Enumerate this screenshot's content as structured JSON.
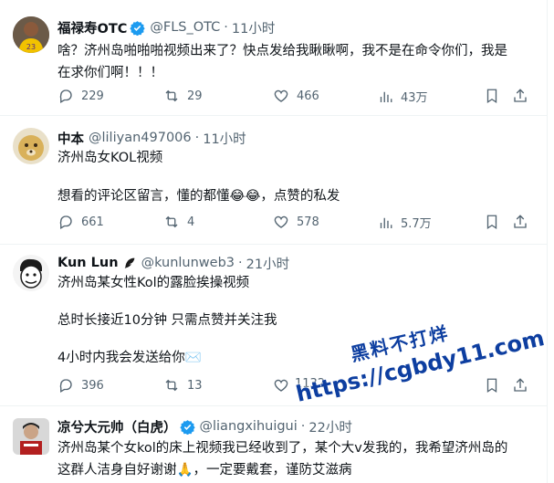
{
  "tweets": [
    {
      "name": "福禄寿OTC",
      "verified": true,
      "handle": "@FLS_OTC",
      "time": "11小时",
      "lines": [
        "啥？济州岛啪啪啪视频出来了？快点发给我瞅瞅啊，我不是在命令你们，我是",
        "在求你们啊！！！"
      ],
      "replies": "229",
      "retweets": "29",
      "likes": "466",
      "views": "43万"
    },
    {
      "name": "中本",
      "verified": false,
      "handle": "@liliyan497006",
      "time": "11小时",
      "lines": [
        "济州岛女KOL视频",
        "",
        "想看的评论区留言，懂的都懂😂😂，点赞的私发"
      ],
      "replies": "661",
      "retweets": "4",
      "likes": "578",
      "views": "5.7万"
    },
    {
      "name": "Kun Lun",
      "verified": false,
      "handle": "@kunlunweb3",
      "time": "21小时",
      "lines": [
        "济州岛某女性Kol的露脸挨操视频",
        "",
        "总时长接近10分钟 只需点赞并关注我",
        "",
        "4小时内我会发送给你✉️"
      ],
      "replies": "396",
      "retweets": "13",
      "likes": "",
      "views": "1132"
    },
    {
      "name": "凉兮大元帅（白虎）",
      "verified": true,
      "handle": "@liangxihuigui",
      "time": "22小时",
      "lines": [
        "济州岛某个女kol的床上视频我已经收到了，某个大v发我的，我希望济州岛的",
        "这群人洁身自好谢谢🙏，一定要戴套，谨防艾滋病"
      ],
      "replies": "",
      "retweets": "",
      "likes": "",
      "views": ""
    }
  ],
  "watermark": {
    "line1": "黑料不打烊",
    "line2": "https://cgbdy11.com"
  },
  "colors": {
    "verified": "#1d9bf0",
    "muted": "#536471",
    "text": "#0f1419",
    "watermark": "#0d3ea0"
  }
}
